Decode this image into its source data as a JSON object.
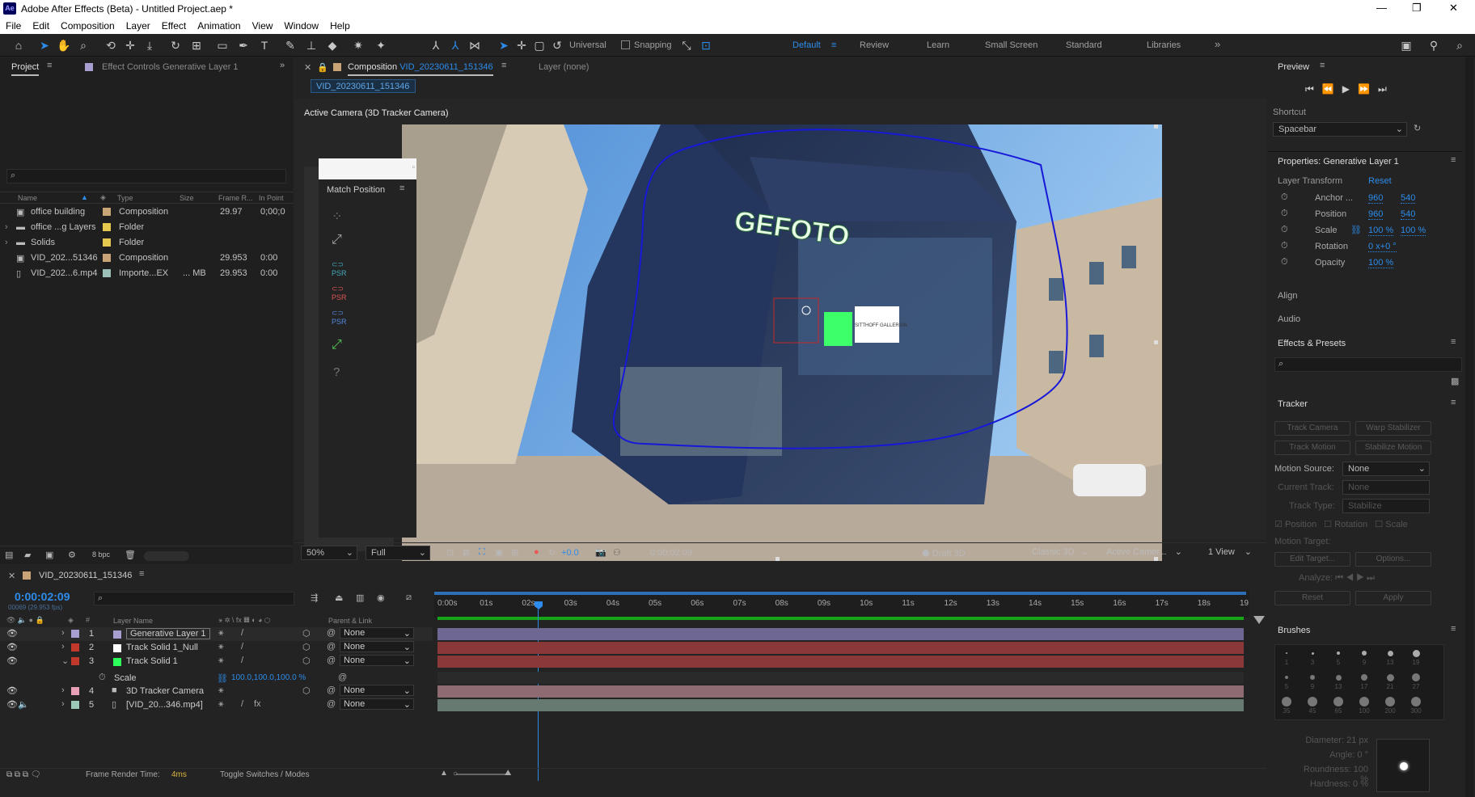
{
  "app": {
    "title": "Adobe After Effects (Beta) - Untitled Project.aep *",
    "logo": "Ae"
  },
  "menu": [
    "File",
    "Edit",
    "Composition",
    "Layer",
    "Effect",
    "Animation",
    "View",
    "Window",
    "Help"
  ],
  "toolbar": {
    "universal": "Universal",
    "snapping": "Snapping",
    "workspaces": [
      "Default",
      "Review",
      "Learn",
      "Small Screen",
      "Standard",
      "Libraries"
    ],
    "more": "»"
  },
  "project_panel": {
    "tab_project": "Project",
    "tab_effect": "Effect Controls  Generative Layer 1",
    "columns": {
      "name": "Name",
      "type": "Type",
      "size": "Size",
      "frame_rate": "Frame R...",
      "in_point": "In Point"
    },
    "items": [
      {
        "name": "office building",
        "type": "Composition",
        "size": "",
        "fr": "29.97",
        "in": "0;00;0",
        "color": "#c8a476",
        "icon": "comp"
      },
      {
        "name": "office ...g Layers",
        "type": "Folder",
        "size": "",
        "fr": "",
        "in": "",
        "color": "#e5c94e",
        "icon": "folder"
      },
      {
        "name": "Solids",
        "type": "Folder",
        "size": "",
        "fr": "",
        "in": "",
        "color": "#e5c94e",
        "icon": "folder"
      },
      {
        "name": "VID_202...51346",
        "type": "Composition",
        "size": "",
        "fr": "29.953",
        "in": "0:00",
        "color": "#c8a476",
        "icon": "comp"
      },
      {
        "name": "VID_202...6.mp4",
        "type": "Importe...EX",
        "size": "... MB",
        "fr": "29.953",
        "in": "0:00",
        "color": "#9bbfb6",
        "icon": "file"
      }
    ],
    "bpc": "8 bpc"
  },
  "comp_panel": {
    "tab": "Composition",
    "comp_name": "VID_20230611_151346",
    "layer_tab": "Layer  (none)",
    "subtab": "VID_20230611_151346",
    "camera_label": "Active Camera (3D Tracker Camera)",
    "match_position": "Match Position",
    "sign_text": "GEFOTO",
    "store_text": "SITTHOFF GALLERIAN",
    "bottom": {
      "zoom": "50%",
      "resolution": "Full",
      "exposure": "+0.0",
      "timecode": "0:00:02:09",
      "draft3d": "Draft 3D",
      "renderer": "Classic 3D",
      "view": "Active Camer...",
      "views": "1 View"
    }
  },
  "preview": {
    "title": "Preview",
    "shortcut_label": "Shortcut",
    "shortcut_value": "Spacebar"
  },
  "properties": {
    "title": "Properties: Generative Layer 1",
    "layer_transform": "Layer Transform",
    "reset": "Reset",
    "rows": [
      {
        "label": "Anchor ...",
        "v1": "960",
        "v2": "540"
      },
      {
        "label": "Position",
        "v1": "960",
        "v2": "540"
      },
      {
        "label": "Scale",
        "v1": "100 %",
        "v2": "100 %"
      },
      {
        "label": "Rotation",
        "v1": "0 x+0 °",
        "v2": ""
      },
      {
        "label": "Opacity",
        "v1": "100 %",
        "v2": ""
      }
    ],
    "align": "Align",
    "audio": "Audio",
    "effects_presets": "Effects & Presets"
  },
  "tracker": {
    "title": "Tracker",
    "track_camera": "Track Camera",
    "warp_stabilizer": "Warp Stabilizer",
    "track_motion": "Track Motion",
    "stabilize_motion": "Stabilize Motion",
    "motion_source_label": "Motion Source:",
    "motion_source": "None",
    "current_track_label": "Current Track:",
    "current_track": "None",
    "track_type_label": "Track Type:",
    "track_type": "Stabilize",
    "position": "Position",
    "rotation": "Rotation",
    "scale": "Scale",
    "motion_target": "Motion Target:",
    "edit_target": "Edit Target...",
    "options": "Options...",
    "analyze": "Analyze:",
    "reset": "Reset",
    "apply": "Apply"
  },
  "brushes": {
    "title": "Brushes",
    "sizes": [
      "1",
      "3",
      "5",
      "9",
      "13",
      "19",
      "5",
      "9",
      "13",
      "17",
      "21",
      "27",
      "35",
      "45",
      "65",
      "100",
      "200",
      "300"
    ],
    "diameter": "Diameter: 21 px",
    "angle": "Angle: 0 °",
    "roundness": "Roundness: 100 %",
    "hardness": "Hardness: 0 %"
  },
  "timeline": {
    "tab": "VID_20230611_151346",
    "timecode": "0:00:02:09",
    "sub_timecode": "00069 (29.953 fps)",
    "col_layer_name": "Layer Name",
    "col_parent": "Parent & Link",
    "layers": [
      {
        "num": "1",
        "name": "Generative Layer 1",
        "color": "#a89fd0",
        "swatch": "#a89fd0",
        "parent": "None",
        "bar": "#6e6793"
      },
      {
        "num": "2",
        "name": "Track Solid 1_Null",
        "color": "#c0392b",
        "swatch": "#ffffff",
        "parent": "None",
        "bar": "#8a3838"
      },
      {
        "num": "3",
        "name": "Track Solid 1",
        "color": "#c0392b",
        "swatch": "#2cff5c",
        "parent": "None",
        "bar": "#8a3838"
      },
      {
        "num": "4",
        "name": "3D Tracker Camera",
        "color": "#e7a0b6",
        "swatch": "",
        "parent": "None",
        "bar": "#8e6a72"
      },
      {
        "num": "5",
        "name": "[VID_20...346.mp4]",
        "color": "#9bc9b8",
        "swatch": "",
        "parent": "None",
        "bar": "#667a72"
      }
    ],
    "scale_label": "Scale",
    "scale_value": "100.0,100.0,100.0 %",
    "ticks": [
      "0:00s",
      "01s",
      "02s",
      "03s",
      "04s",
      "05s",
      "06s",
      "07s",
      "08s",
      "09s",
      "10s",
      "11s",
      "12s",
      "13s",
      "14s",
      "15s",
      "16s",
      "17s",
      "18s",
      "19"
    ],
    "frame_render_label": "Frame Render Time:",
    "frame_render_value": "4ms",
    "toggle": "Toggle Switches / Modes"
  }
}
